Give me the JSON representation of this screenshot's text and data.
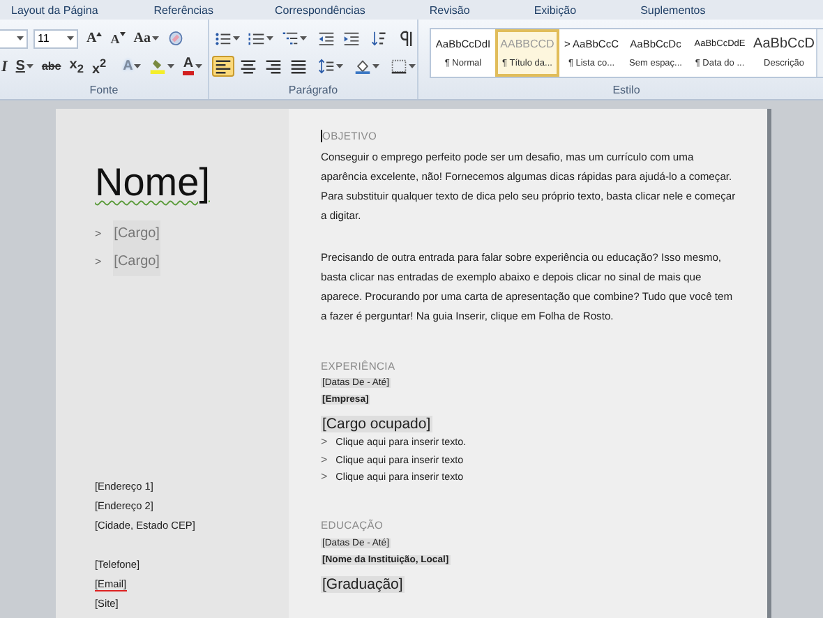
{
  "menu_tabs": [
    {
      "label": "Layout da Página",
      "selected": false
    },
    {
      "label": "Referências",
      "selected": false
    },
    {
      "label": "Correspondências",
      "selected": false
    },
    {
      "label": "Revisão",
      "selected": false
    },
    {
      "label": "Exibição",
      "selected": false
    },
    {
      "label": "Suplementos",
      "selected": false
    }
  ],
  "ribbon": {
    "font_group": {
      "label": "Fonte",
      "font_size": "11",
      "upper_tools": [
        {
          "kind": "grow",
          "label": "A"
        },
        {
          "kind": "shrink",
          "label": "A"
        },
        {
          "kind": "case",
          "label": "Aa"
        },
        {
          "kind": "clear-format"
        }
      ],
      "lower_tools": [
        {
          "kind": "italic",
          "label": "I"
        },
        {
          "kind": "underline",
          "label": "S"
        },
        {
          "kind": "strike",
          "label": "abc"
        },
        {
          "kind": "subscript",
          "label": "x$_{2}$"
        },
        {
          "kind": "superscript",
          "label": "x$^{2}$"
        },
        {
          "kind": "text-effects",
          "label": "A"
        },
        {
          "kind": "highlight"
        },
        {
          "kind": "font-color",
          "label": "A"
        }
      ]
    },
    "paragraph_group": {
      "label": "Parágrafo",
      "upper_tools": [
        {
          "kind": "bullets"
        },
        {
          "kind": "numbering"
        },
        {
          "kind": "multilevel"
        },
        {
          "kind": "outdent"
        },
        {
          "kind": "indent"
        },
        {
          "kind": "sort"
        },
        {
          "kind": "pilcrow"
        }
      ],
      "alignment": [
        {
          "kind": "align-left",
          "selected": true
        },
        {
          "kind": "align-center",
          "selected": false
        },
        {
          "kind": "align-right",
          "selected": false
        },
        {
          "kind": "justify",
          "selected": false
        }
      ],
      "lower_tools": [
        {
          "kind": "line-spacing"
        },
        {
          "kind": "shading"
        },
        {
          "kind": "borders"
        }
      ]
    },
    "styles_group": {
      "label": "Estilo",
      "styles": [
        {
          "sample": "AaBbCcDdI",
          "name": "¶ Normal",
          "kind": "normal",
          "selected": false
        },
        {
          "sample": "AABBCCD",
          "name": "¶ Título da...",
          "kind": "caps",
          "selected": true
        },
        {
          "sample": "> AaBbCcC",
          "name": "¶ Lista co...",
          "kind": "normal",
          "selected": false
        },
        {
          "sample": "AaBbCcDc",
          "name": "Sem espaç...",
          "kind": "medium",
          "selected": false
        },
        {
          "sample": "AaBbCcDdE",
          "name": "¶ Data do ...",
          "kind": "small",
          "selected": false
        },
        {
          "sample": "AaBbCcD",
          "name": "Descrição",
          "kind": "large",
          "selected": false
        }
      ]
    }
  },
  "document": {
    "left": {
      "name": "Nome]",
      "name_grammar_mark": true,
      "positions": [
        {
          "marker": ">",
          "text": "[Cargo]"
        },
        {
          "marker": ">",
          "text": "[Cargo]"
        }
      ],
      "address": [
        "[Endereço 1]",
        "[Endereço 2]",
        "[Cidade, Estado CEP]"
      ],
      "contacts": [
        {
          "text": "[Telefone]",
          "spelling_error": false
        },
        {
          "text": "[Email]",
          "spelling_error": true
        },
        {
          "text": "[Site]",
          "spelling_error": false
        }
      ]
    },
    "right": [
      {
        "kind": "text",
        "heading": "OBJETIVO",
        "cursor": true,
        "paragraphs": [
          "Conseguir o emprego perfeito pode ser um desafio, mas  um currículo com uma aparência excelente, não!  Fornecemos algumas  dicas rápidas para ajudá-lo a começar.  Para substituir  qualquer texto de dica pelo seu próprio texto, basta clicar nele e começar a digitar.",
          "Precisando de outra entrada para falar sobre experiência ou educação? Isso mesmo,  basta clicar nas entradas de exemplo abaixo e depois clicar no sinal de mais que aparece. Procurando por uma carta de apresentação que combine? Tudo que você tem a fazer é perguntar!  Na guia Inserir, clique em Folha de Rosto."
        ]
      },
      {
        "kind": "entry",
        "heading": "EXPERIÊNCIA",
        "dates": "[Datas De - Até]",
        "organization": "[Empresa]",
        "title": "[Cargo ocupado]",
        "bullets": [
          {
            "marker": ">",
            "text": "Clique aqui para inserir texto."
          },
          {
            "marker": ">",
            "text": "Clique aqui para inserir texto"
          },
          {
            "marker": ">",
            "text": "Clique aqui para inserir texto"
          }
        ]
      },
      {
        "kind": "entry",
        "heading": "EDUCAÇÃO",
        "dates": "[Datas De - Até]",
        "organization": "[Nome da Instituição, Local]",
        "title": "[Graduação]"
      }
    ]
  }
}
